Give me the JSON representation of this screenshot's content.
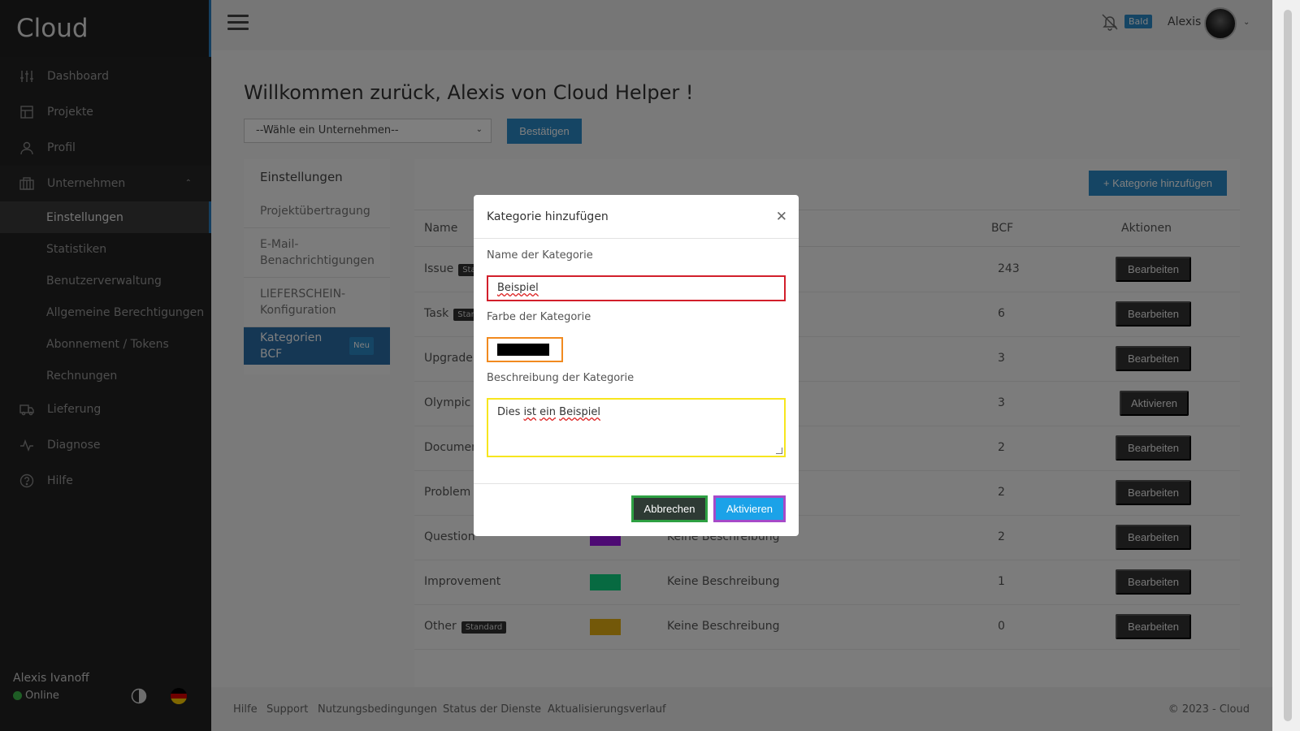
{
  "brand": "Cloud",
  "sidebar": {
    "items": [
      {
        "label": "Dashboard",
        "icon": "sliders-icon"
      },
      {
        "label": "Projekte",
        "icon": "layout-icon"
      },
      {
        "label": "Profil",
        "icon": "user-icon"
      },
      {
        "label": "Unternehmen",
        "icon": "building-icon"
      }
    ],
    "subitems": [
      "Einstellungen",
      "Statistiken",
      "Benutzerverwaltung",
      "Allgemeine Berechtigungen",
      "Abonnement / Tokens",
      "Rechnungen"
    ],
    "items_after": [
      {
        "label": "Lieferung",
        "icon": "truck-icon"
      },
      {
        "label": "Diagnose",
        "icon": "activity-icon"
      },
      {
        "label": "Hilfe",
        "icon": "help-icon"
      }
    ],
    "user_name": "Alexis Ivanoff",
    "user_status": "Online"
  },
  "topbar": {
    "soon_badge": "Bald",
    "user": "Alexis"
  },
  "main": {
    "welcome": "Willkommen zurück, Alexis von Cloud Helper !",
    "select_placeholder": "--Wähle ein Unternehmen--",
    "confirm_label": "Bestätigen",
    "settings_title": "Einstellungen",
    "settings_links": [
      "Projektübertragung",
      "E-Mail-Benachrichtigungen",
      "LIEFERSCHEIN-Konfiguration"
    ],
    "settings_active": "Kategorien BCF",
    "new_badge": "Neu",
    "add_category_label": "+ Kategorie hinzufügen",
    "table": {
      "headers": {
        "name": "Name",
        "bcf": "BCF",
        "actions": "Aktionen"
      },
      "rows": [
        {
          "name": "Issue",
          "badge": "Sta",
          "desc": "",
          "color": "",
          "bcf": "243",
          "action": "Bearbeiten"
        },
        {
          "name": "Task",
          "badge": "Star",
          "desc": "",
          "color": "",
          "bcf": "6",
          "action": "Bearbeiten"
        },
        {
          "name": "Upgrade",
          "badge": "",
          "desc": "",
          "color": "",
          "bcf": "3",
          "action": "Bearbeiten"
        },
        {
          "name": "Olympic",
          "badge": "",
          "desc": "",
          "color": "",
          "bcf": "3",
          "action": "Aktivieren"
        },
        {
          "name": "Document",
          "badge": "",
          "desc": "",
          "color": "",
          "bcf": "2",
          "action": "Bearbeiten"
        },
        {
          "name": "Problem",
          "badge": "",
          "desc": "",
          "color": "",
          "bcf": "2",
          "action": "Bearbeiten"
        },
        {
          "name": "Question",
          "badge": "",
          "desc": "Keine Beschreibung",
          "color": "#9b14e6",
          "bcf": "2",
          "action": "Bearbeiten"
        },
        {
          "name": "Improvement",
          "badge": "",
          "desc": "Keine Beschreibung",
          "color": "#0fd482",
          "bcf": "1",
          "action": "Bearbeiten"
        },
        {
          "name": "Other",
          "badge": "Standard",
          "desc": "Keine Beschreibung",
          "color": "#e6b012",
          "bcf": "0",
          "action": "Bearbeiten"
        }
      ]
    }
  },
  "footer": {
    "links": [
      "Hilfe",
      "Support",
      "Nutzungsbedingungen",
      "Status der Dienste",
      "Aktualisierungsverlauf"
    ],
    "copyright": "© 2023 - Cloud"
  },
  "modal": {
    "title": "Kategorie hinzufügen",
    "name_label": "Name der Kategorie",
    "name_value": "Beispiel",
    "color_label": "Farbe der Kategorie",
    "color_value": "#000000",
    "desc_label": "Beschreibung der Kategorie",
    "desc_value_plain1": "Dies ",
    "desc_value_ul1": "ist",
    "desc_value_plain2": " ",
    "desc_value_ul2": "ein",
    "desc_value_plain3": " ",
    "desc_value_ul3": "Beispiel",
    "cancel_label": "Abbrechen",
    "activate_label": "Aktivieren"
  }
}
